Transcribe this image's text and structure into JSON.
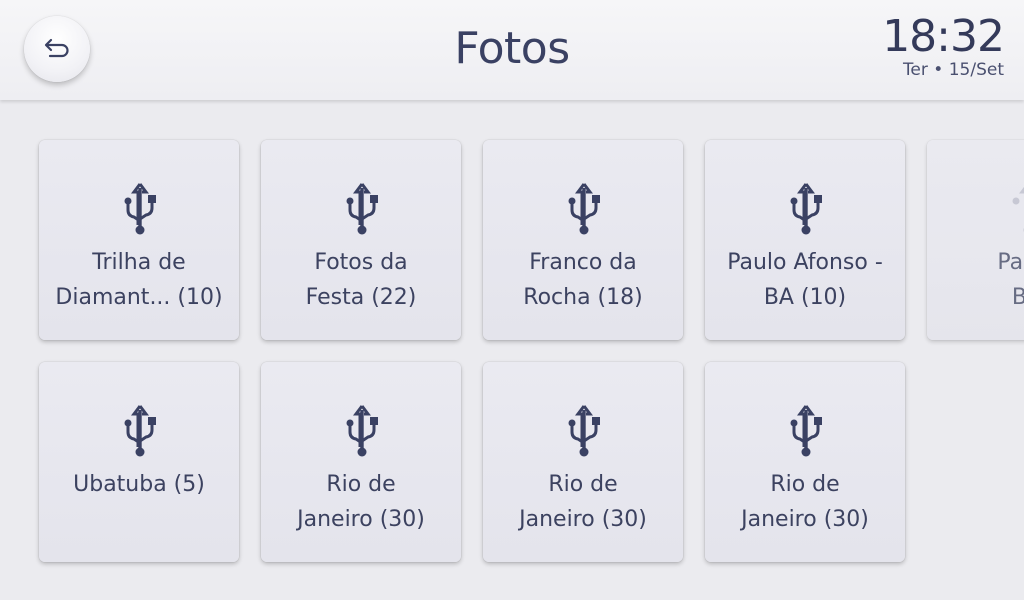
{
  "header": {
    "title": "Fotos",
    "time": "18:32",
    "date": "Ter • 15/Set"
  },
  "folders": [
    {
      "label": "Trilha de\nDiamant... (10)",
      "icon": "usb-icon"
    },
    {
      "label": "Fotos da\nFesta (22)",
      "icon": "usb-icon"
    },
    {
      "label": "Franco da\nRocha (18)",
      "icon": "usb-icon"
    },
    {
      "label": "Paulo Afonso -\nBA (10)",
      "icon": "usb-icon"
    },
    {
      "label": "Paulo\nBA",
      "icon": "usb-icon"
    },
    {
      "label": "Ubatuba (5)",
      "icon": "usb-icon"
    },
    {
      "label": "Rio de\nJaneiro (30)",
      "icon": "usb-icon"
    },
    {
      "label": "Rio de\nJaneiro (30)",
      "icon": "usb-icon"
    },
    {
      "label": "Rio de\nJaneiro (30)",
      "icon": "usb-icon"
    }
  ],
  "colors": {
    "accent": "#3a4163",
    "background": "#ebebef",
    "tile": "#e7e7ee"
  }
}
